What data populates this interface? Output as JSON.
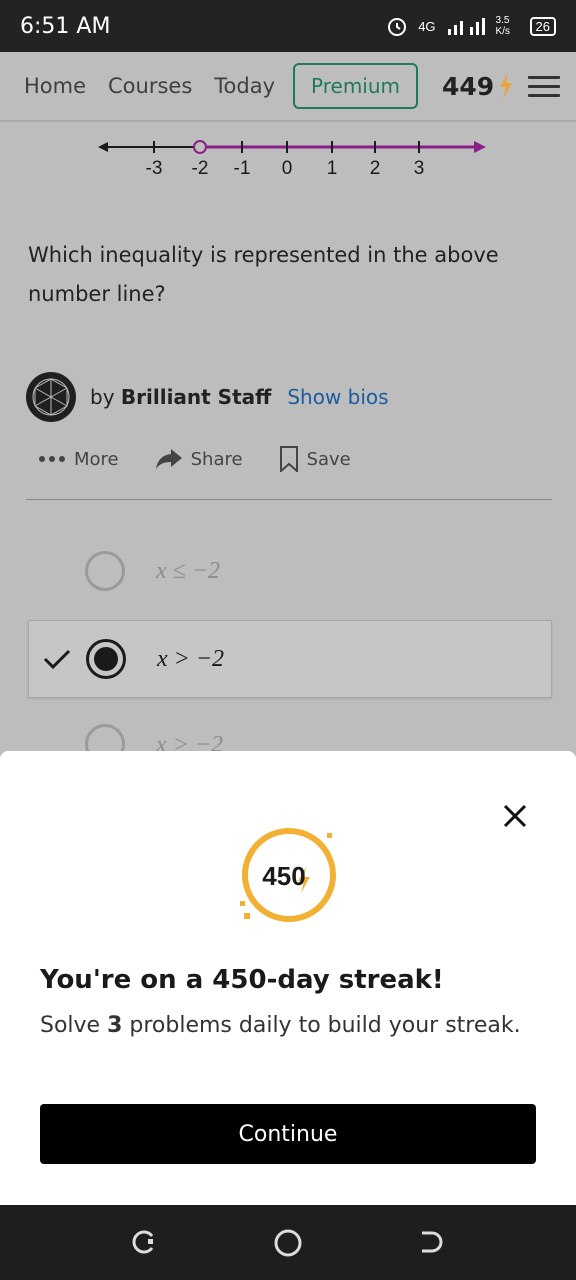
{
  "status_bar": {
    "time": "6:51 AM",
    "network": "4G",
    "speed": "3.5 K/s",
    "battery": "26"
  },
  "nav": {
    "links": [
      "Home",
      "Courses",
      "Today"
    ],
    "premium_label": "Premium",
    "streak_count": "449"
  },
  "number_line": {
    "tick_labels": [
      "-3",
      "-2",
      "-1",
      "0",
      "1",
      "2",
      "3"
    ],
    "open_point": -2,
    "direction": "right",
    "shade_color": "#8a1f8a"
  },
  "question": {
    "text": "Which inequality is represented in the above number line?"
  },
  "author": {
    "by": "by",
    "name": "Brilliant Staff",
    "show_bios": "Show bios"
  },
  "actions": {
    "more": "More",
    "share": "Share",
    "save": "Save"
  },
  "options": [
    {
      "text": "x ≤ −2",
      "selected": false
    },
    {
      "text": "x > −2",
      "selected": true
    },
    {
      "text": "x > −2",
      "selected": false
    }
  ],
  "modal": {
    "badge_number": "450",
    "title": "You're on a 450-day streak!",
    "subtitle_pre": "Solve ",
    "subtitle_bold": "3",
    "subtitle_post": " problems daily to build your streak.",
    "continue_label": "Continue"
  },
  "colors": {
    "accent_green": "#1f7a5b",
    "streak_gold": "#f2b134",
    "link_blue": "#1a5c9e"
  },
  "icons": [
    "alarm-icon",
    "signal-icon",
    "battery-icon",
    "bolt-icon",
    "menu-icon",
    "more-dots-icon",
    "share-arrow-icon",
    "bookmark-icon",
    "check-icon",
    "close-icon",
    "recent-apps-icon",
    "home-icon",
    "back-icon"
  ]
}
